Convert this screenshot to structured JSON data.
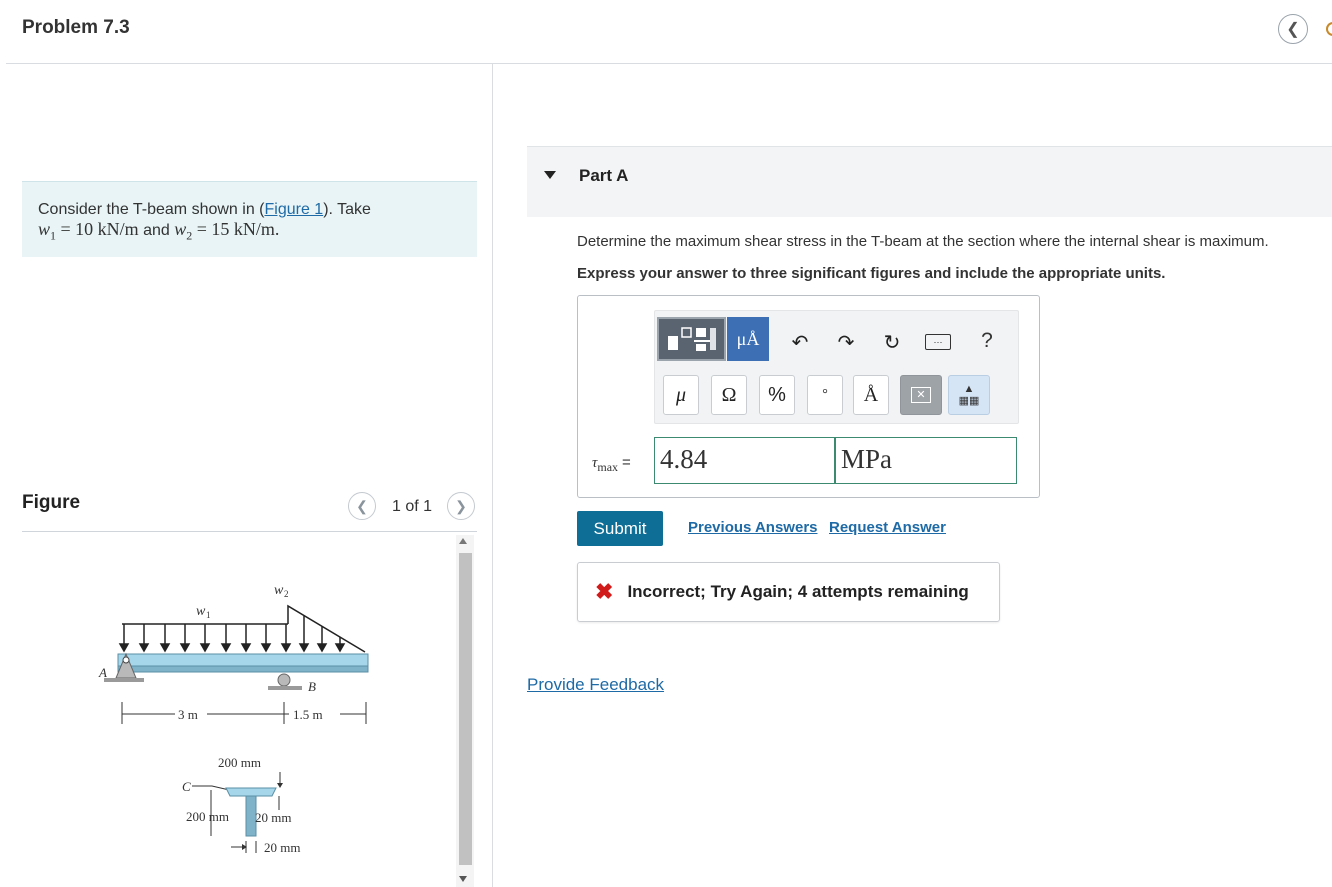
{
  "header": {
    "title": "Problem 7.3"
  },
  "intro": {
    "text_before_link": "Consider the T-beam shown in (",
    "link_text": "Figure 1",
    "text_after_link": "). Take",
    "w1_symbol": "w",
    "w1_sub": "1",
    "w1_value": " = 10 kN/m",
    "and_text": " and ",
    "w2_symbol": "w",
    "w2_sub": "2",
    "w2_value": " = 15 kN/m."
  },
  "figure": {
    "label": "Figure",
    "counter": "1 of 1",
    "beam": {
      "w1": "w",
      "w1_sub": "1",
      "w2": "w",
      "w2_sub": "2",
      "support_a": "A",
      "support_b": "B",
      "dim_left": "3 m",
      "dim_right": "1.5 m"
    },
    "section": {
      "point_c": "C",
      "flange_width": "200 mm",
      "web_height": "200 mm",
      "flange_thickness": "20 mm",
      "web_thickness": "20 mm"
    }
  },
  "part": {
    "title": "Part A",
    "question": "Determine the maximum shear stress in the T-beam at the section where the internal shear is maximum.",
    "instruction": "Express your answer to three significant figures and include the appropriate units."
  },
  "toolbar": {
    "unit_button": "μÅ",
    "help": "?",
    "symbols": [
      "μ",
      "Ω",
      "%",
      "°",
      "Å"
    ]
  },
  "answer": {
    "label_symbol": "τ",
    "label_sub": "max",
    "label_eq": "=",
    "value": "4.84",
    "unit": "MPa"
  },
  "actions": {
    "submit": "Submit",
    "previous_answers": "Previous Answers",
    "request_answer": "Request Answer"
  },
  "feedback": {
    "text": "Incorrect; Try Again; 4 attempts remaining"
  },
  "footer": {
    "provide_feedback": "Provide Feedback"
  },
  "colors": {
    "accent": "#0f6e96",
    "link": "#1e6aa6",
    "error": "#d11b1b",
    "beam": "#a6d6ea",
    "intro_bg": "#e8f4f6"
  }
}
